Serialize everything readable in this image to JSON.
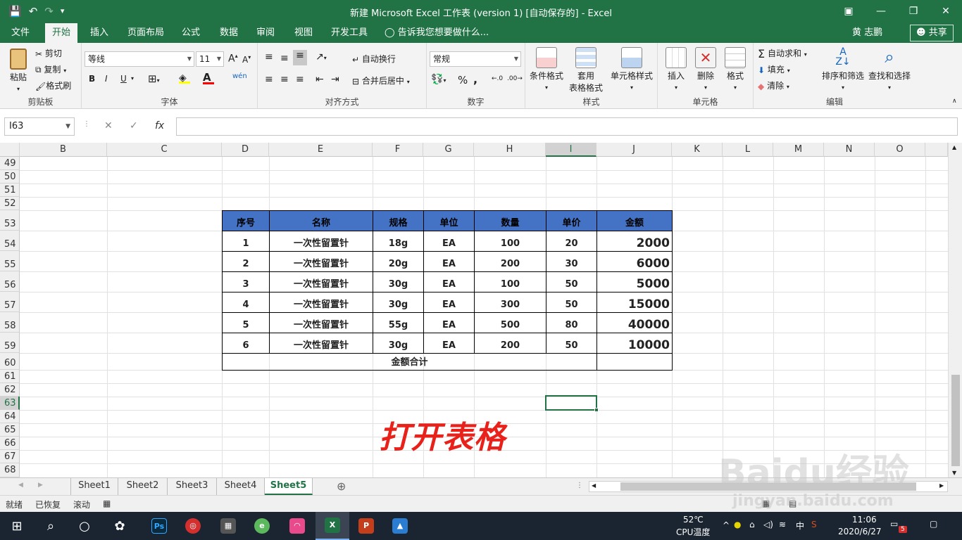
{
  "window": {
    "title": "新建 Microsoft Excel 工作表 (version 1) [自动保存的] - Excel",
    "minimize": "—",
    "maximize": "❐",
    "close": "✕",
    "restore_ribbon": "▣"
  },
  "qat": {
    "save_icon": "save-icon",
    "undo": "↶",
    "redo": "↷",
    "customize": "▾"
  },
  "tabs": [
    "文件",
    "开始",
    "插入",
    "页面布局",
    "公式",
    "数据",
    "审阅",
    "视图",
    "开发工具"
  ],
  "active_tab": "开始",
  "tell_me": "告诉我您想要做什么...",
  "user_name": "黄 志鹏",
  "share_label": "共享",
  "ribbon": {
    "clipboard": {
      "label": "剪贴板",
      "paste": "粘贴",
      "cut": "剪切",
      "copy": "复制",
      "format_painter": "格式刷"
    },
    "font": {
      "label": "字体",
      "font_name": "等线",
      "font_size": "11",
      "grow": "A",
      "shrink": "A",
      "bold": "B",
      "italic": "I",
      "underline": "U",
      "wen": "wén"
    },
    "alignment": {
      "label": "对齐方式",
      "wrap": "自动换行",
      "merge": "合并后居中"
    },
    "number": {
      "label": "数字",
      "format": "常规",
      "percent": "%",
      "comma": ","
    },
    "styles": {
      "label": "样式",
      "cond_format": "条件格式",
      "table_format_1": "套用",
      "table_format_2": "表格格式",
      "cell_styles": "单元格样式"
    },
    "cells": {
      "label": "单元格",
      "insert": "插入",
      "delete": "删除",
      "format": "格式"
    },
    "editing": {
      "label": "编辑",
      "autosum": "自动求和",
      "fill": "填充",
      "clear": "清除",
      "sort_filter": "排序和筛选",
      "find_select": "查找和选择"
    }
  },
  "formula_bar": {
    "name_box": "I63",
    "cancel": "✕",
    "enter": "✓",
    "fx": "fx",
    "value": ""
  },
  "columns": [
    "B",
    "C",
    "D",
    "E",
    "F",
    "G",
    "H",
    "I",
    "J",
    "K",
    "L",
    "M",
    "N",
    "O"
  ],
  "selected_column": "I",
  "rows": [
    "49",
    "50",
    "51",
    "52",
    "53",
    "54",
    "55",
    "56",
    "57",
    "58",
    "59",
    "60",
    "61",
    "62",
    "63",
    "64",
    "65",
    "66",
    "67",
    "68"
  ],
  "selected_row": "63",
  "table": {
    "headers": [
      "序号",
      "名称",
      "规格",
      "单位",
      "数量",
      "单价",
      "金额"
    ],
    "rows": [
      [
        "1",
        "一次性留置针",
        "18g",
        "EA",
        "100",
        "20",
        "2000"
      ],
      [
        "2",
        "一次性留置针",
        "20g",
        "EA",
        "200",
        "30",
        "6000"
      ],
      [
        "3",
        "一次性留置针",
        "30g",
        "EA",
        "100",
        "50",
        "5000"
      ],
      [
        "4",
        "一次性留置针",
        "30g",
        "EA",
        "300",
        "50",
        "15000"
      ],
      [
        "5",
        "一次性留置针",
        "55g",
        "EA",
        "500",
        "80",
        "40000"
      ],
      [
        "6",
        "一次性留置针",
        "30g",
        "EA",
        "200",
        "50",
        "10000"
      ]
    ],
    "total_label": "金额合计",
    "total_value": ""
  },
  "overlay_caption": "打开表格",
  "sheets": [
    "Sheet1",
    "Sheet2",
    "Sheet3",
    "Sheet4",
    "Sheet5"
  ],
  "active_sheet": "Sheet5",
  "add_sheet": "⊕",
  "status": {
    "ready": "就绪",
    "recovered": "已恢复",
    "scroll": "滚动"
  },
  "taskbar": {
    "cpu_temp": "52℃",
    "cpu_label": "CPU温度",
    "time": "11:06",
    "date": "2020/6/27",
    "ime": "中",
    "notification_count": "5"
  },
  "watermark": {
    "main": "Baidu经验",
    "sub": "jingyan.baidu.com"
  },
  "colors": {
    "excel_green": "#217346",
    "table_header_blue": "#4472c4",
    "overlay_red": "#e8221b"
  }
}
